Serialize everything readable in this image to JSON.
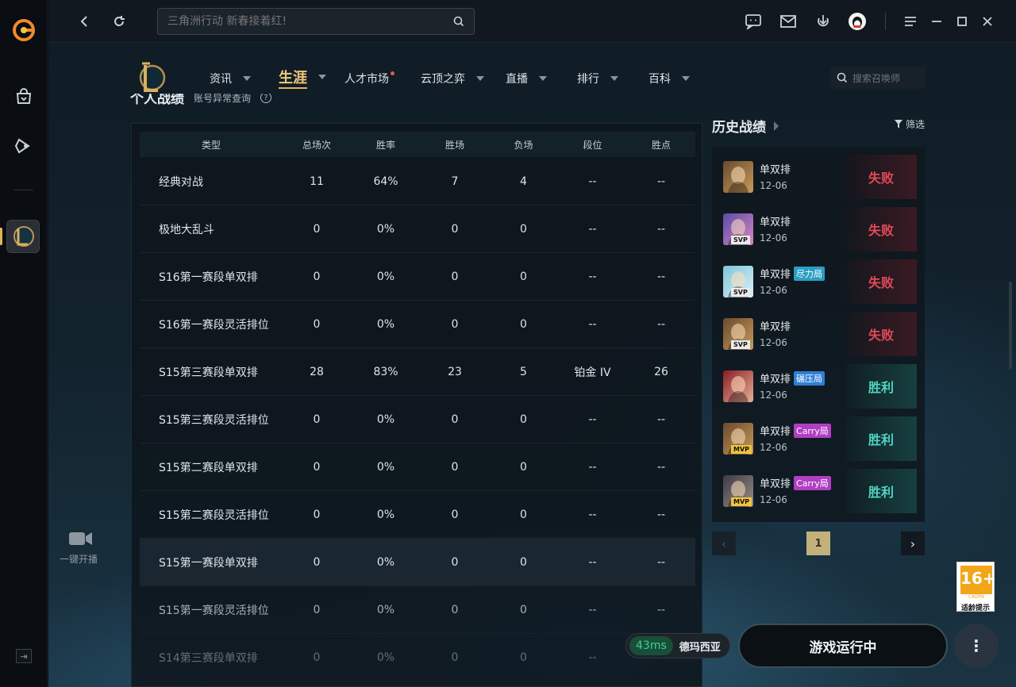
{
  "topbar": {
    "search_placeholder": "三角洲行动 新春接着红!"
  },
  "rail": {
    "live_label": "一键开播"
  },
  "nav": {
    "items": [
      {
        "label": "资讯"
      },
      {
        "label": "生涯",
        "active": true
      },
      {
        "label": "人才市场",
        "dot": true
      },
      {
        "label": "云顶之弈"
      },
      {
        "label": "直播"
      },
      {
        "label": "排行"
      },
      {
        "label": "百科"
      }
    ],
    "search_placeholder": "搜索召唤师"
  },
  "stats_panel": {
    "title": "个人战绩",
    "subtitle": "账号异常查询",
    "columns": [
      "类型",
      "总场次",
      "胜率",
      "胜场",
      "负场",
      "段位",
      "胜点"
    ],
    "rows": [
      [
        "经典对战",
        "11",
        "64%",
        "7",
        "4",
        "--",
        "--"
      ],
      [
        "极地大乱斗",
        "0",
        "0%",
        "0",
        "0",
        "--",
        "--"
      ],
      [
        "S16第一赛段单双排",
        "0",
        "0%",
        "0",
        "0",
        "--",
        "--"
      ],
      [
        "S16第一赛段灵活排位",
        "0",
        "0%",
        "0",
        "0",
        "--",
        "--"
      ],
      [
        "S15第三赛段单双排",
        "28",
        "83%",
        "23",
        "5",
        "铂金 IV",
        "26"
      ],
      [
        "S15第三赛段灵活排位",
        "0",
        "0%",
        "0",
        "0",
        "--",
        "--"
      ],
      [
        "S15第二赛段单双排",
        "0",
        "0%",
        "0",
        "0",
        "--",
        "--"
      ],
      [
        "S15第二赛段灵活排位",
        "0",
        "0%",
        "0",
        "0",
        "--",
        "--"
      ],
      [
        "S15第一赛段单双排",
        "0",
        "0%",
        "0",
        "0",
        "--",
        "--"
      ],
      [
        "S15第一赛段灵活排位",
        "0",
        "0%",
        "0",
        "0",
        "--",
        "--"
      ],
      [
        "S14第三赛段单双排",
        "0",
        "0%",
        "0",
        "0",
        "--",
        "--"
      ]
    ]
  },
  "history": {
    "title": "历史战绩",
    "filter_label": "筛选",
    "matches": [
      {
        "mode": "单双排",
        "date": "12-06",
        "result": "失败",
        "win": false,
        "badge": "",
        "tag": "",
        "tag_color": ""
      },
      {
        "mode": "单双排",
        "date": "12-06",
        "result": "失败",
        "win": false,
        "badge": "SVP",
        "tag": "",
        "tag_color": ""
      },
      {
        "mode": "单双排",
        "date": "12-06",
        "result": "失败",
        "win": false,
        "badge": "SVP",
        "tag": "尽力局",
        "tag_color": "#2a9fc4"
      },
      {
        "mode": "单双排",
        "date": "12-06",
        "result": "失败",
        "win": false,
        "badge": "SVP",
        "tag": "",
        "tag_color": ""
      },
      {
        "mode": "单双排",
        "date": "12-06",
        "result": "胜利",
        "win": true,
        "badge": "",
        "tag": "碾压局",
        "tag_color": "#2f7fd6"
      },
      {
        "mode": "单双排",
        "date": "12-06",
        "result": "胜利",
        "win": true,
        "badge": "MVP",
        "tag": "Carry局",
        "tag_color": "#b13fc2"
      },
      {
        "mode": "单双排",
        "date": "12-06",
        "result": "胜利",
        "win": true,
        "badge": "MVP",
        "tag": "Carry局",
        "tag_color": "#b13fc2"
      }
    ],
    "page": "1"
  },
  "age_rating": {
    "label": "适龄提示",
    "value": "16+",
    "org": "CADPA"
  },
  "status": {
    "ping": "43ms",
    "server": "德玛西亚",
    "game_state": "游戏运行中"
  },
  "colors": {
    "accent_gold": "#e0b35a",
    "lose_red": "#e14a59",
    "win_teal": "#4fd5c3",
    "ping_green": "#36d58b"
  }
}
